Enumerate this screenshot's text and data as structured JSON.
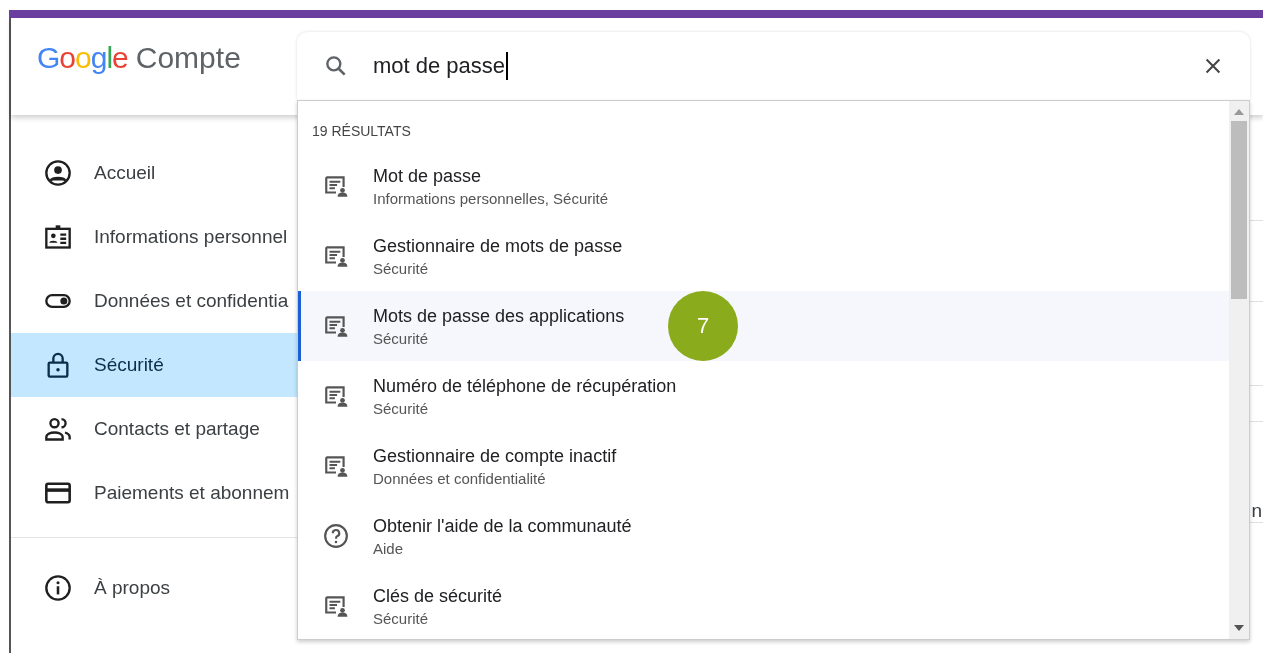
{
  "header": {
    "logo": "Google",
    "product": "Compte"
  },
  "search": {
    "value": "mot de passe"
  },
  "sidebar": {
    "items": [
      {
        "label": "Accueil",
        "kind": "account",
        "selected": false
      },
      {
        "label": "Informations personnel",
        "kind": "id",
        "selected": false
      },
      {
        "label": "Données et confidentia",
        "kind": "toggle",
        "selected": false
      },
      {
        "label": "Sécurité",
        "kind": "lock",
        "selected": true
      },
      {
        "label": "Contacts et partage",
        "kind": "people",
        "selected": false
      },
      {
        "label": "Paiements et abonnem",
        "kind": "card",
        "selected": false
      }
    ],
    "footer_items": [
      {
        "label": "À propos",
        "kind": "info",
        "selected": false
      }
    ]
  },
  "results": {
    "count_label": "19 RÉSULTATS",
    "items": [
      {
        "title": "Mot de passe",
        "subtitle": "Informations personnelles, Sécurité",
        "kind": "setting",
        "selected": false
      },
      {
        "title": "Gestionnaire de mots de passe",
        "subtitle": "Sécurité",
        "kind": "setting",
        "selected": false
      },
      {
        "title": "Mots de passe des applications",
        "subtitle": "Sécurité",
        "kind": "setting",
        "selected": true
      },
      {
        "title": "Numéro de téléphone de récupération",
        "subtitle": "Sécurité",
        "kind": "setting",
        "selected": false
      },
      {
        "title": "Gestionnaire de compte inactif",
        "subtitle": "Données et confidentialité",
        "kind": "setting",
        "selected": false
      },
      {
        "title": "Obtenir l'aide de la communauté",
        "subtitle": "Aide",
        "kind": "help",
        "selected": false
      },
      {
        "title": "Clés de sécurité",
        "subtitle": "Sécurité",
        "kind": "setting",
        "selected": false
      }
    ]
  },
  "annotation": {
    "label": "7"
  },
  "background_text": "n"
}
